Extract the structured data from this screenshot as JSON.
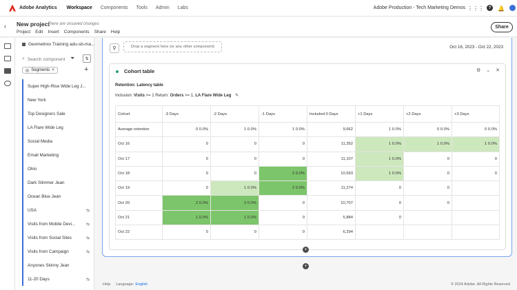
{
  "topnav": {
    "brand": "Adobe Analytics",
    "links": [
      "Workspace",
      "Components",
      "Tools",
      "Admin",
      "Labs"
    ],
    "org": "Adobe Production - Tech Marketing Demos",
    "help_glyph": "?"
  },
  "project": {
    "title": "New project",
    "unsaved": "There are unsaved changes",
    "menu": [
      "Project",
      "Edit",
      "Insert",
      "Components",
      "Share",
      "Help"
    ],
    "share_label": "Share"
  },
  "panel": {
    "suite": "Geometrixx Training adu-sb-ma...",
    "search_placeholder": "Search component",
    "chip_label": "Segments",
    "segments": [
      {
        "label": "Super High-Rise Wide Leg J...",
        "shared": false
      },
      {
        "label": "New York",
        "shared": false
      },
      {
        "label": "Top Designers Sale",
        "shared": false
      },
      {
        "label": "LA Flare Wide Leg",
        "shared": false
      },
      {
        "label": "Social Media",
        "shared": false
      },
      {
        "label": "Email Marketing",
        "shared": false
      },
      {
        "label": "Ohio",
        "shared": false
      },
      {
        "label": "Dark Slimmer Jean",
        "shared": false
      },
      {
        "label": "Ocean Blue Jean",
        "shared": false
      },
      {
        "label": "USA",
        "shared": true
      },
      {
        "label": "Visits from Mobile Devi...",
        "shared": true
      },
      {
        "label": "Visits from Social Sites",
        "shared": true
      },
      {
        "label": "Visits from Campaign",
        "shared": true
      },
      {
        "label": "Anyones Skinny Jean",
        "shared": false
      },
      {
        "label": "11-20 Days",
        "shared": true
      }
    ]
  },
  "canvas": {
    "dropzone": "Drop a segment here (or any other component)",
    "date_range": "Oct 16, 2023 - Oct 22, 2023"
  },
  "cohort": {
    "title": "Cohort table",
    "retention": "Retention: Latency table",
    "inclusion_prefix": "Inclusion:",
    "inclusion_metric": "Visits",
    "inclusion_rest": ">= 1 Return:",
    "return_metric": "Orders",
    "return_rest": ">= 1,",
    "segment": "LA Flare Wide Leg",
    "headers": [
      "Cohort",
      "-3 Days",
      "-2 Days",
      "-1 Days",
      "Included 0 Days",
      "+1 Days",
      "+2 Days",
      "+3 Days"
    ],
    "rows": [
      {
        "label": "Average retention",
        "cells": [
          "0   0.0%",
          "1   0.0%",
          "1   0.0%",
          "9,662",
          "1   0.0%",
          "0   0.0%",
          "0   0.0%"
        ],
        "levels": [
          0,
          0,
          0,
          0,
          0,
          0,
          0
        ]
      },
      {
        "label": "Oct 16",
        "cells": [
          "0",
          "0",
          "0",
          "11,352",
          "1   0.0%",
          "1   0.0%",
          "1   0.0%"
        ],
        "levels": [
          0,
          0,
          0,
          0,
          1,
          1,
          1
        ]
      },
      {
        "label": "Oct 17",
        "cells": [
          "0",
          "0",
          "0",
          "11,107",
          "1   0.0%",
          "0",
          "0"
        ],
        "levels": [
          0,
          0,
          0,
          0,
          1,
          0,
          0
        ]
      },
      {
        "label": "Oct 18",
        "cells": [
          "0",
          "0",
          "2   0.0%",
          "10,593",
          "1   0.0%",
          "0",
          "0"
        ],
        "levels": [
          0,
          0,
          2,
          0,
          1,
          0,
          0
        ]
      },
      {
        "label": "Oct 19",
        "cells": [
          "0",
          "1   0.0%",
          "2   0.0%",
          "11,274",
          "0",
          "0",
          ""
        ],
        "levels": [
          0,
          1,
          2,
          0,
          0,
          0,
          0
        ]
      },
      {
        "label": "Oct 20",
        "cells": [
          "2   0.0%",
          "2   0.0%",
          "0",
          "10,707",
          "0",
          "0",
          ""
        ],
        "levels": [
          2,
          2,
          0,
          0,
          0,
          0,
          0
        ]
      },
      {
        "label": "Oct 21",
        "cells": [
          "1   0.0%",
          "1   0.0%",
          "0",
          "5,884",
          "0",
          "",
          ""
        ],
        "levels": [
          2,
          2,
          0,
          0,
          0,
          0,
          0
        ]
      },
      {
        "label": "Oct 22",
        "cells": [
          "0",
          "0",
          "0",
          "6,294",
          "",
          "",
          ""
        ],
        "levels": [
          0,
          0,
          0,
          0,
          0,
          0,
          0
        ]
      }
    ]
  },
  "footer": {
    "help": "Help",
    "language_label": "Language:",
    "language_value": "English",
    "copyright": "© 2024 Adobe. All Rights Reserved"
  },
  "colors": {
    "accent": "#3b6fd8",
    "heat_light": "#cde8bd",
    "heat_dark": "#7cc56a"
  }
}
